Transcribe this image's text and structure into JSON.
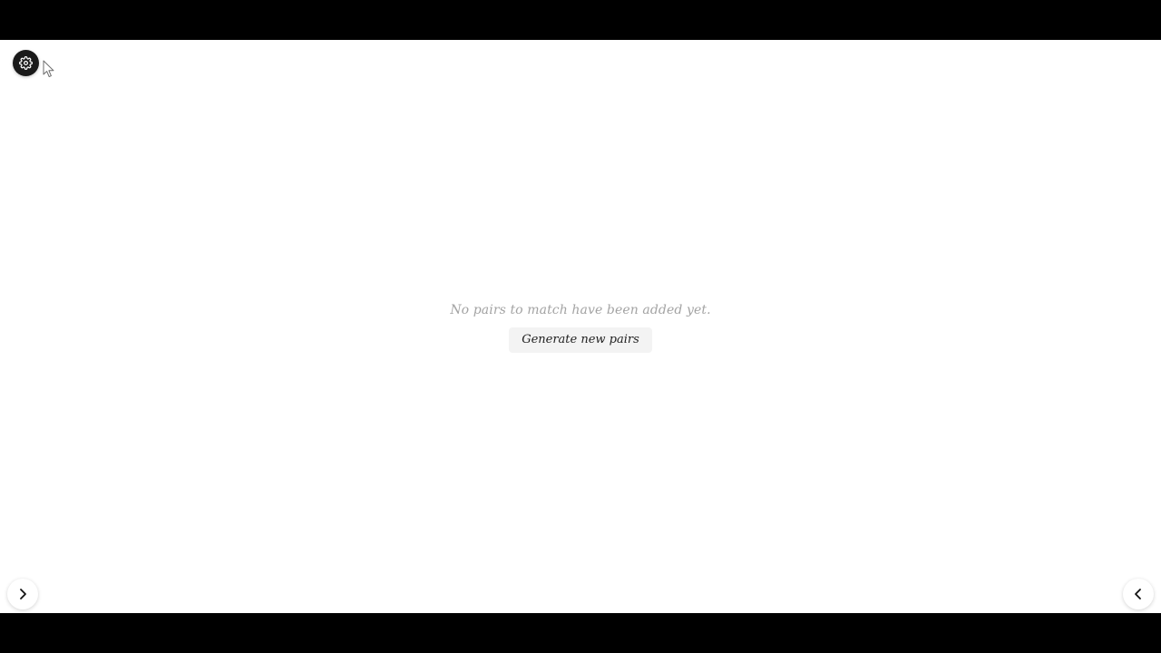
{
  "empty_state": {
    "message": "No pairs to match have been added yet.",
    "generate_label": "Generate new pairs"
  },
  "icons": {
    "settings": "gear-icon",
    "next": "chevron-right-icon",
    "previous": "chevron-left-icon",
    "cursor": "mouse-pointer-icon"
  },
  "colors": {
    "letterbox": "#000000",
    "canvas": "#ffffff",
    "settings_button": "#1a1a1a",
    "message_text": "#a3a3a3",
    "button_bg": "#f3f3f3",
    "button_text": "#1f1f1f"
  }
}
